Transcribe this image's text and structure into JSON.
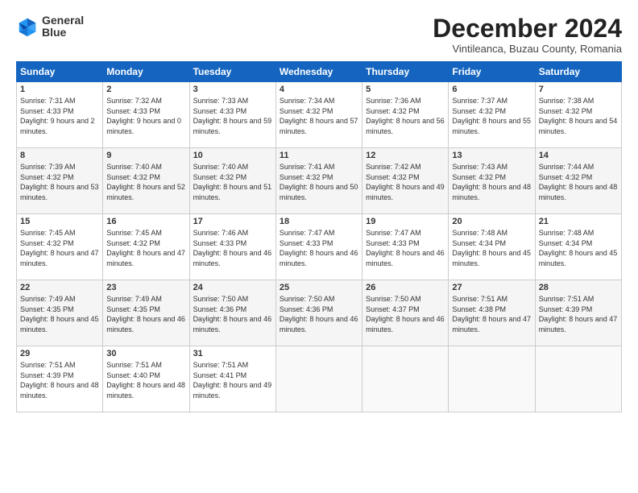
{
  "logo": {
    "line1": "General",
    "line2": "Blue"
  },
  "header": {
    "month_title": "December 2024",
    "subtitle": "Vintileanca, Buzau County, Romania"
  },
  "weekdays": [
    "Sunday",
    "Monday",
    "Tuesday",
    "Wednesday",
    "Thursday",
    "Friday",
    "Saturday"
  ],
  "weeks": [
    [
      {
        "day": "1",
        "rise": "Sunrise: 7:31 AM",
        "set": "Sunset: 4:33 PM",
        "daylight": "Daylight: 9 hours and 2 minutes."
      },
      {
        "day": "2",
        "rise": "Sunrise: 7:32 AM",
        "set": "Sunset: 4:33 PM",
        "daylight": "Daylight: 9 hours and 0 minutes."
      },
      {
        "day": "3",
        "rise": "Sunrise: 7:33 AM",
        "set": "Sunset: 4:33 PM",
        "daylight": "Daylight: 8 hours and 59 minutes."
      },
      {
        "day": "4",
        "rise": "Sunrise: 7:34 AM",
        "set": "Sunset: 4:32 PM",
        "daylight": "Daylight: 8 hours and 57 minutes."
      },
      {
        "day": "5",
        "rise": "Sunrise: 7:36 AM",
        "set": "Sunset: 4:32 PM",
        "daylight": "Daylight: 8 hours and 56 minutes."
      },
      {
        "day": "6",
        "rise": "Sunrise: 7:37 AM",
        "set": "Sunset: 4:32 PM",
        "daylight": "Daylight: 8 hours and 55 minutes."
      },
      {
        "day": "7",
        "rise": "Sunrise: 7:38 AM",
        "set": "Sunset: 4:32 PM",
        "daylight": "Daylight: 8 hours and 54 minutes."
      }
    ],
    [
      {
        "day": "8",
        "rise": "Sunrise: 7:39 AM",
        "set": "Sunset: 4:32 PM",
        "daylight": "Daylight: 8 hours and 53 minutes."
      },
      {
        "day": "9",
        "rise": "Sunrise: 7:40 AM",
        "set": "Sunset: 4:32 PM",
        "daylight": "Daylight: 8 hours and 52 minutes."
      },
      {
        "day": "10",
        "rise": "Sunrise: 7:40 AM",
        "set": "Sunset: 4:32 PM",
        "daylight": "Daylight: 8 hours and 51 minutes."
      },
      {
        "day": "11",
        "rise": "Sunrise: 7:41 AM",
        "set": "Sunset: 4:32 PM",
        "daylight": "Daylight: 8 hours and 50 minutes."
      },
      {
        "day": "12",
        "rise": "Sunrise: 7:42 AM",
        "set": "Sunset: 4:32 PM",
        "daylight": "Daylight: 8 hours and 49 minutes."
      },
      {
        "day": "13",
        "rise": "Sunrise: 7:43 AM",
        "set": "Sunset: 4:32 PM",
        "daylight": "Daylight: 8 hours and 48 minutes."
      },
      {
        "day": "14",
        "rise": "Sunrise: 7:44 AM",
        "set": "Sunset: 4:32 PM",
        "daylight": "Daylight: 8 hours and 48 minutes."
      }
    ],
    [
      {
        "day": "15",
        "rise": "Sunrise: 7:45 AM",
        "set": "Sunset: 4:32 PM",
        "daylight": "Daylight: 8 hours and 47 minutes."
      },
      {
        "day": "16",
        "rise": "Sunrise: 7:45 AM",
        "set": "Sunset: 4:32 PM",
        "daylight": "Daylight: 8 hours and 47 minutes."
      },
      {
        "day": "17",
        "rise": "Sunrise: 7:46 AM",
        "set": "Sunset: 4:33 PM",
        "daylight": "Daylight: 8 hours and 46 minutes."
      },
      {
        "day": "18",
        "rise": "Sunrise: 7:47 AM",
        "set": "Sunset: 4:33 PM",
        "daylight": "Daylight: 8 hours and 46 minutes."
      },
      {
        "day": "19",
        "rise": "Sunrise: 7:47 AM",
        "set": "Sunset: 4:33 PM",
        "daylight": "Daylight: 8 hours and 46 minutes."
      },
      {
        "day": "20",
        "rise": "Sunrise: 7:48 AM",
        "set": "Sunset: 4:34 PM",
        "daylight": "Daylight: 8 hours and 45 minutes."
      },
      {
        "day": "21",
        "rise": "Sunrise: 7:48 AM",
        "set": "Sunset: 4:34 PM",
        "daylight": "Daylight: 8 hours and 45 minutes."
      }
    ],
    [
      {
        "day": "22",
        "rise": "Sunrise: 7:49 AM",
        "set": "Sunset: 4:35 PM",
        "daylight": "Daylight: 8 hours and 45 minutes."
      },
      {
        "day": "23",
        "rise": "Sunrise: 7:49 AM",
        "set": "Sunset: 4:35 PM",
        "daylight": "Daylight: 8 hours and 46 minutes."
      },
      {
        "day": "24",
        "rise": "Sunrise: 7:50 AM",
        "set": "Sunset: 4:36 PM",
        "daylight": "Daylight: 8 hours and 46 minutes."
      },
      {
        "day": "25",
        "rise": "Sunrise: 7:50 AM",
        "set": "Sunset: 4:36 PM",
        "daylight": "Daylight: 8 hours and 46 minutes."
      },
      {
        "day": "26",
        "rise": "Sunrise: 7:50 AM",
        "set": "Sunset: 4:37 PM",
        "daylight": "Daylight: 8 hours and 46 minutes."
      },
      {
        "day": "27",
        "rise": "Sunrise: 7:51 AM",
        "set": "Sunset: 4:38 PM",
        "daylight": "Daylight: 8 hours and 47 minutes."
      },
      {
        "day": "28",
        "rise": "Sunrise: 7:51 AM",
        "set": "Sunset: 4:39 PM",
        "daylight": "Daylight: 8 hours and 47 minutes."
      }
    ],
    [
      {
        "day": "29",
        "rise": "Sunrise: 7:51 AM",
        "set": "Sunset: 4:39 PM",
        "daylight": "Daylight: 8 hours and 48 minutes."
      },
      {
        "day": "30",
        "rise": "Sunrise: 7:51 AM",
        "set": "Sunset: 4:40 PM",
        "daylight": "Daylight: 8 hours and 48 minutes."
      },
      {
        "day": "31",
        "rise": "Sunrise: 7:51 AM",
        "set": "Sunset: 4:41 PM",
        "daylight": "Daylight: 8 hours and 49 minutes."
      },
      null,
      null,
      null,
      null
    ]
  ]
}
